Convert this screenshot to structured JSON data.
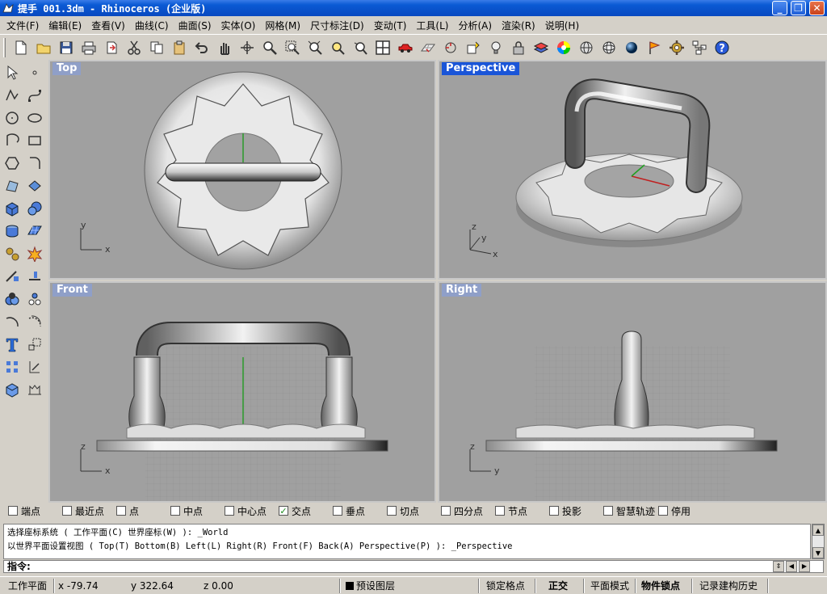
{
  "window": {
    "title": "提手 001.3dm - Rhinoceros (企业版)",
    "minimize": "_",
    "maximize": "❐",
    "close": "✕"
  },
  "menu": [
    "文件(F)",
    "编辑(E)",
    "查看(V)",
    "曲线(C)",
    "曲面(S)",
    "实体(O)",
    "网格(M)",
    "尺寸标注(D)",
    "变动(T)",
    "工具(L)",
    "分析(A)",
    "渲染(R)",
    "说明(H)"
  ],
  "viewports": {
    "top": {
      "label": "Top",
      "axis_y": "y",
      "axis_x": "x"
    },
    "perspective": {
      "label": "Perspective",
      "axis_z": "z",
      "axis_y": "y",
      "axis_x": "x"
    },
    "front": {
      "label": "Front",
      "axis_z": "z",
      "axis_x": "x"
    },
    "right": {
      "label": "Right",
      "axis_z": "z",
      "axis_y": "y"
    }
  },
  "osnaps": [
    {
      "label": "端点",
      "checked": false
    },
    {
      "label": "最近点",
      "checked": false
    },
    {
      "label": "点",
      "checked": false
    },
    {
      "label": "中点",
      "checked": false
    },
    {
      "label": "中心点",
      "checked": false
    },
    {
      "label": "交点",
      "checked": true
    },
    {
      "label": "垂点",
      "checked": false
    },
    {
      "label": "切点",
      "checked": false
    },
    {
      "label": "四分点",
      "checked": false
    },
    {
      "label": "节点",
      "checked": false
    },
    {
      "label": "投影",
      "checked": false
    },
    {
      "label": "智慧轨迹",
      "checked": false
    },
    {
      "label": "停用",
      "checked": false
    }
  ],
  "command": {
    "history_1": "选择座标系统 ( 工作平面(C) 世界座标(W) ): _World",
    "history_2": "以世界平面设置视图 ( Top(T) Bottom(B) Left(L) Right(R) Front(F) Back(A) Perspective(P) ): _Perspective",
    "prompt": "指令:"
  },
  "status": {
    "cplane": "工作平面",
    "x": "x -79.74",
    "y": "y 322.64",
    "z": "z 0.00",
    "layer": "预设图层",
    "grid_snap": "锁定格点",
    "ortho": "正交",
    "planar": "平面模式",
    "osnap": "物件锁点",
    "history": "记录建构历史"
  },
  "colors": {
    "titlebar": "#0a5ad4",
    "active_label": "#1a55d8",
    "inactive_label": "#8f9fc8",
    "viewport_bg": "#a0a0a0"
  }
}
